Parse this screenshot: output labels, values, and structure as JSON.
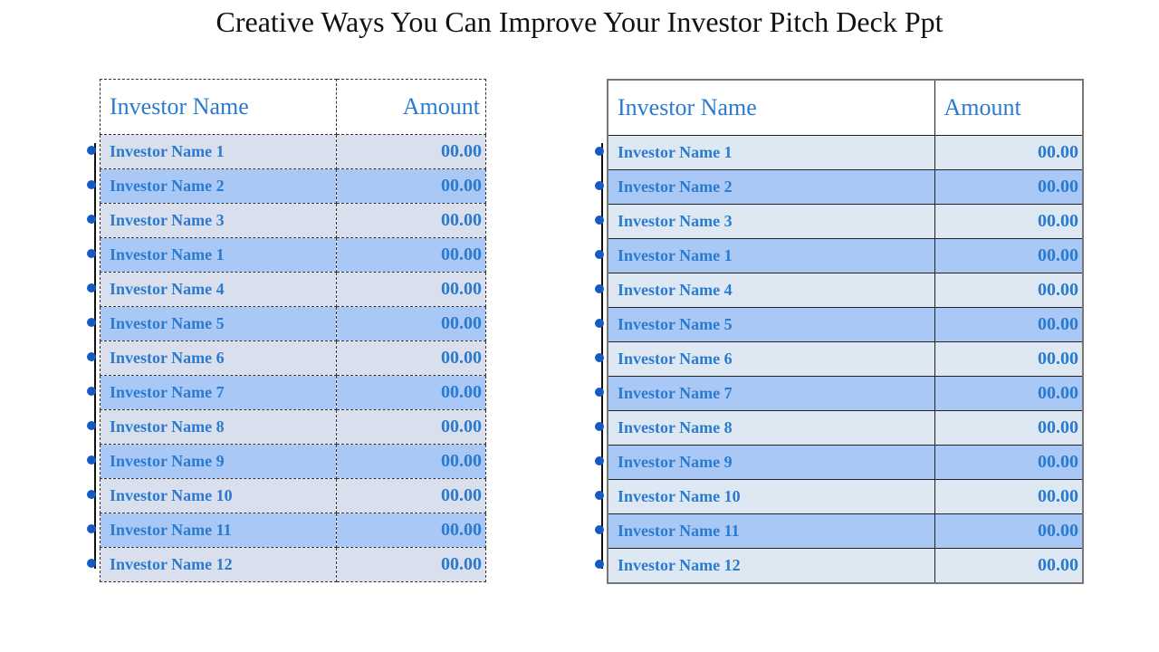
{
  "title": "Creative Ways You Can Improve Your Investor Pitch Deck Ppt",
  "tables": [
    {
      "headers": {
        "name": "Investor Name",
        "amount": "Amount"
      },
      "rows": [
        {
          "name": "Investor Name 1",
          "amount": "00.00"
        },
        {
          "name": "Investor Name 2",
          "amount": "00.00"
        },
        {
          "name": "Investor Name 3",
          "amount": "00.00"
        },
        {
          "name": "Investor Name 1",
          "amount": "00.00"
        },
        {
          "name": "Investor Name 4",
          "amount": "00.00"
        },
        {
          "name": "Investor Name 5",
          "amount": "00.00"
        },
        {
          "name": "Investor Name 6",
          "amount": "00.00"
        },
        {
          "name": "Investor Name 7",
          "amount": "00.00"
        },
        {
          "name": "Investor Name 8",
          "amount": "00.00"
        },
        {
          "name": "Investor Name 9",
          "amount": "00.00"
        },
        {
          "name": "Investor Name 10",
          "amount": "00.00"
        },
        {
          "name": "Investor Name 11",
          "amount": "00.00"
        },
        {
          "name": "Investor Name 12",
          "amount": "00.00"
        }
      ]
    },
    {
      "headers": {
        "name": "Investor Name",
        "amount": "Amount"
      },
      "rows": [
        {
          "name": "Investor Name 1",
          "amount": "00.00"
        },
        {
          "name": "Investor Name 2",
          "amount": "00.00"
        },
        {
          "name": "Investor Name 3",
          "amount": "00.00"
        },
        {
          "name": "Investor Name 1",
          "amount": "00.00"
        },
        {
          "name": "Investor Name 4",
          "amount": "00.00"
        },
        {
          "name": "Investor Name 5",
          "amount": "00.00"
        },
        {
          "name": "Investor Name 6",
          "amount": "00.00"
        },
        {
          "name": "Investor Name 7",
          "amount": "00.00"
        },
        {
          "name": "Investor Name 8",
          "amount": "00.00"
        },
        {
          "name": "Investor Name 9",
          "amount": "00.00"
        },
        {
          "name": "Investor Name 10",
          "amount": "00.00"
        },
        {
          "name": "Investor Name 11",
          "amount": "00.00"
        },
        {
          "name": "Investor Name 12",
          "amount": "00.00"
        }
      ]
    }
  ]
}
